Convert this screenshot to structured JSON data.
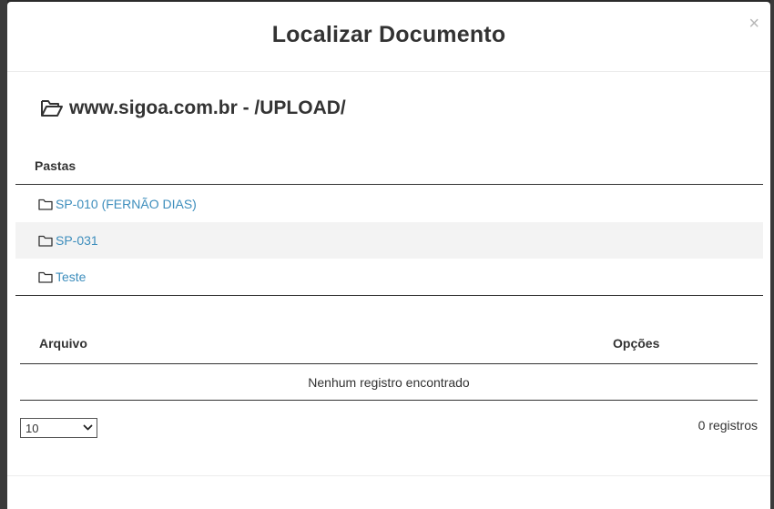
{
  "modal": {
    "title": "Localizar Documento",
    "close_label": "×"
  },
  "path": {
    "icon": "folder-open-icon",
    "text": "www.sigoa.com.br - /UPLOAD/"
  },
  "folders": {
    "header": "Pastas",
    "items": [
      {
        "icon": "folder-icon",
        "label": "SP-010 (FERNÃO DIAS)"
      },
      {
        "icon": "folder-icon",
        "label": "SP-031"
      },
      {
        "icon": "folder-icon",
        "label": "Teste"
      }
    ]
  },
  "files": {
    "columns": {
      "arquivo": "Arquivo",
      "opcoes": "Opções"
    },
    "empty_message": "Nenhum registro encontrado"
  },
  "pagination": {
    "page_size": "10",
    "records_info": "0 registros"
  },
  "colors": {
    "link": "#3c8dbc",
    "text": "#333333",
    "stripe": "#f3f3f3"
  }
}
